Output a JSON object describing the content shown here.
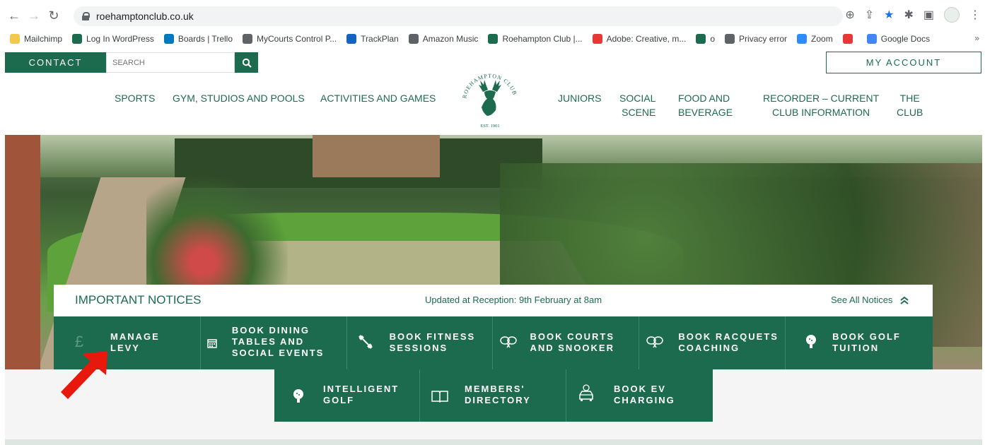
{
  "browser": {
    "url": "roehamptonclub.co.uk",
    "bookmarks": [
      {
        "label": "Mailchimp",
        "color": "#f2c94c"
      },
      {
        "label": "Log In WordPress",
        "color": "#1d6b4f"
      },
      {
        "label": "Boards | Trello",
        "color": "#0079bf"
      },
      {
        "label": "MyCourts Control P...",
        "color": "#5f6368"
      },
      {
        "label": "TrackPlan",
        "color": "#1565c0"
      },
      {
        "label": "Amazon Music",
        "color": "#5f6368"
      },
      {
        "label": "Roehampton Club |...",
        "color": "#1d6b4f"
      },
      {
        "label": "Adobe: Creative, m...",
        "color": "#e53935"
      },
      {
        "label": "o",
        "color": "#1d6b4f"
      },
      {
        "label": "Privacy error",
        "color": "#5f6368"
      },
      {
        "label": "Zoom",
        "color": "#2d8cff"
      },
      {
        "label": "",
        "color": "#e53935"
      },
      {
        "label": "Google Docs",
        "color": "#4285f4"
      }
    ],
    "more": "»"
  },
  "header": {
    "contact_label": "CONTACT",
    "search_placeholder": "SEARCH",
    "account_label": "MY ACCOUNT"
  },
  "nav": {
    "sports": "SPORTS",
    "gym": "GYM, STUDIOS AND POOLS",
    "activities": "ACTIVITIES AND GAMES",
    "juniors": "JUNIORS",
    "social_1": "SOCIAL",
    "social_2": "SCENE",
    "food_1": "FOOD AND",
    "food_2": "BEVERAGE",
    "recorder_1": "RECORDER – CURRENT",
    "recorder_2": "CLUB INFORMATION",
    "club_1": "THE",
    "club_2": "CLUB"
  },
  "logo": {
    "arc_text": "ROEHAMPTON CLUB",
    "est_text": "EST. 1901"
  },
  "notices": {
    "title": "IMPORTANT NOTICES",
    "updated": "Updated at Reception: 9th February at 8am",
    "see_all": "See All Notices"
  },
  "tiles": {
    "levy_1": "MANAGE",
    "levy_2": "LEVY",
    "dining_1": "BOOK DINING",
    "dining_2": "TABLES AND",
    "dining_3": "SOCIAL EVENTS",
    "fitness_1": "BOOK FITNESS",
    "fitness_2": "SESSIONS",
    "courts_1": "BOOK COURTS",
    "courts_2": "AND SNOOKER",
    "racquets_1": "BOOK RACQUETS",
    "racquets_2": "COACHING",
    "golf_1": "BOOK GOLF",
    "golf_2": "TUITION",
    "igolf_1": "INTELLIGENT",
    "igolf_2": "GOLF",
    "dir_1": "MEMBERS'",
    "dir_2": "DIRECTORY",
    "ev_1": "BOOK EV",
    "ev_2": "CHARGING"
  },
  "colors": {
    "brand_green": "#1d6b4f",
    "annotation_arrow": "#e8180c"
  }
}
